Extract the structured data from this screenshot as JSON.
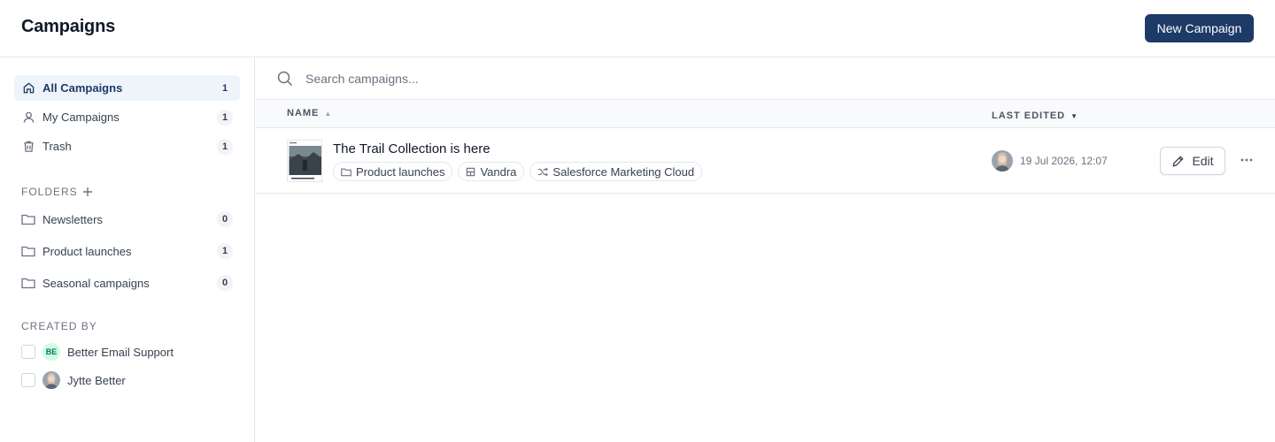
{
  "header": {
    "title": "Campaigns",
    "new_button_label": "New Campaign",
    "accent_color": "#1e3a66"
  },
  "sidebar": {
    "nav": [
      {
        "label": "All Campaigns",
        "count": "1",
        "icon": "home-icon",
        "active": true
      },
      {
        "label": "My Campaigns",
        "count": "1",
        "icon": "user-icon",
        "active": false
      },
      {
        "label": "Trash",
        "count": "1",
        "icon": "trash-icon",
        "active": false
      }
    ],
    "folders_label": "FOLDERS",
    "folders": [
      {
        "label": "Newsletters",
        "count": "0",
        "icon": "folder-icon"
      },
      {
        "label": "Product launches",
        "count": "1",
        "icon": "folder-icon"
      },
      {
        "label": "Seasonal campaigns",
        "count": "0",
        "icon": "folder-icon"
      }
    ],
    "created_by_label": "CREATED BY",
    "creators": [
      {
        "name": "Better Email Support",
        "initials": "BE",
        "checked": false
      },
      {
        "name": "Jytte Better",
        "checked": false
      }
    ]
  },
  "search": {
    "placeholder": "Search campaigns..."
  },
  "table": {
    "columns": {
      "name": "NAME",
      "last_edited": "LAST EDITED"
    },
    "rows": [
      {
        "title": "The Trail Collection is here",
        "tags": [
          {
            "label": "Product launches",
            "icon": "folder-icon"
          },
          {
            "label": "Vandra",
            "icon": "brand-icon"
          },
          {
            "label": "Salesforce Marketing Cloud",
            "icon": "shuffle-icon"
          }
        ],
        "last_edited": "19 Jul 2026, 12:07",
        "edit_label": "Edit"
      }
    ]
  }
}
